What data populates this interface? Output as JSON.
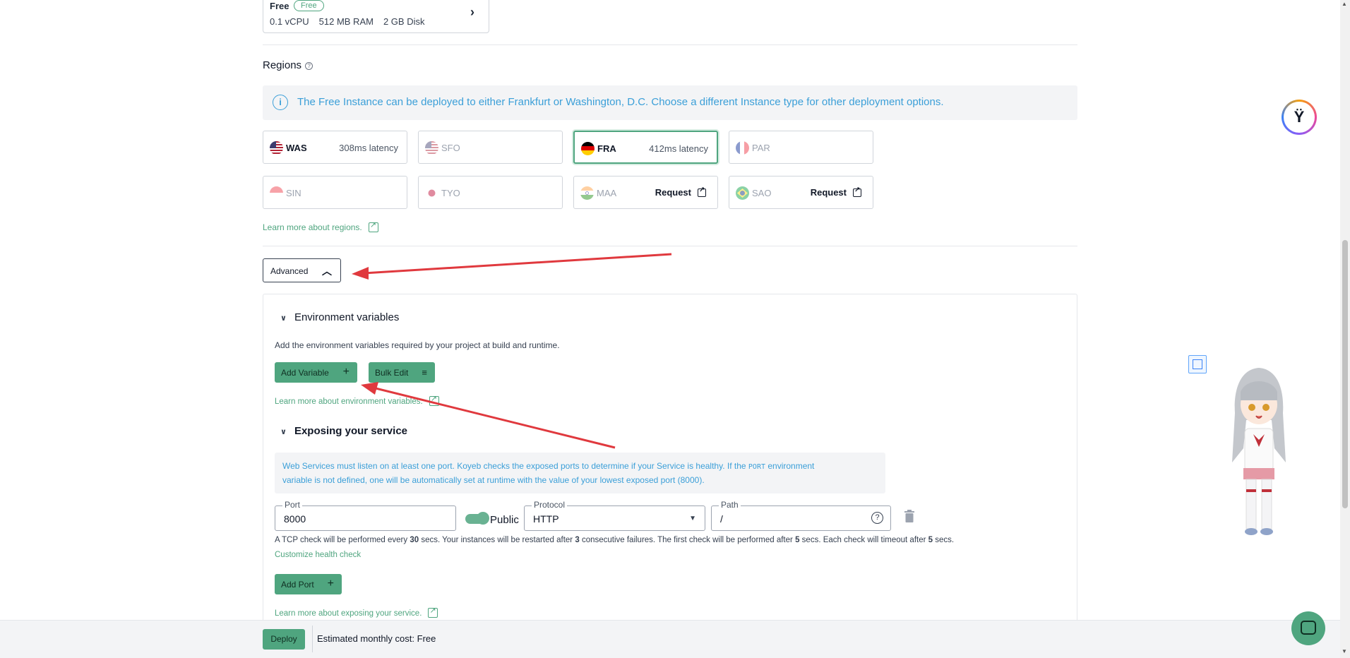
{
  "instance": {
    "name": "Free",
    "badge": "Free",
    "vcpu": "0.1 vCPU",
    "ram": "512 MB RAM",
    "disk": "2 GB Disk"
  },
  "regions": {
    "title": "Regions",
    "info": "The Free Instance can be deployed to either Frankfurt or Washington, D.C. Choose a different Instance type for other deployment options.",
    "items": [
      {
        "code": "WAS",
        "latency": "308ms latency",
        "flag": "us"
      },
      {
        "code": "SFO",
        "latency": "",
        "flag": "us"
      },
      {
        "code": "FRA",
        "latency": "412ms latency",
        "flag": "de"
      },
      {
        "code": "PAR",
        "latency": "",
        "flag": "fr"
      },
      {
        "code": "SIN",
        "latency": "",
        "flag": "sg"
      },
      {
        "code": "TYO",
        "latency": "",
        "flag": "jp"
      },
      {
        "code": "MAA",
        "request": "Request",
        "flag": "in"
      },
      {
        "code": "SAO",
        "request": "Request",
        "flag": "br"
      }
    ],
    "learn_more": "Learn more about regions."
  },
  "advanced": {
    "label": "Advanced"
  },
  "env": {
    "title": "Environment variables",
    "description": "Add the environment variables required by your project at build and runtime.",
    "add_label": "Add Variable",
    "bulk_label": "Bulk Edit",
    "learn_more": "Learn more about environment variables."
  },
  "expose": {
    "title": "Exposing your service",
    "info_1": "Web Services must listen on at least one port. Koyeb checks the exposed ports to determine if your Service is healthy. If the",
    "info_port": "PORT",
    "info_2": "environment",
    "info_3": "variable is not defined, one will be automatically set at runtime with the value of your lowest exposed port (8000).",
    "port_label": "Port",
    "port_value": "8000",
    "public_label": "Public",
    "protocol_label": "Protocol",
    "protocol_value": "HTTP",
    "path_label": "Path",
    "path_value": "/",
    "health_a": "A TCP check will be performed every",
    "health_b": "30",
    "health_c": "secs. Your instances will be restarted after",
    "health_d": "3",
    "health_e": "consecutive failures. The first check will be performed after",
    "health_f": "5",
    "health_g": "secs. Each check will timeout after",
    "health_h": "5",
    "health_i": "secs.",
    "customize": "Customize health check",
    "add_port": "Add Port",
    "learn_more": "Learn more about exposing your service."
  },
  "footer": {
    "deploy": "Deploy",
    "cost_label": "Estimated monthly cost:",
    "cost_value": "Free"
  },
  "colors": {
    "accent": "#4fa57f",
    "info": "#3b9fd8",
    "annotation": "#e0393e"
  }
}
